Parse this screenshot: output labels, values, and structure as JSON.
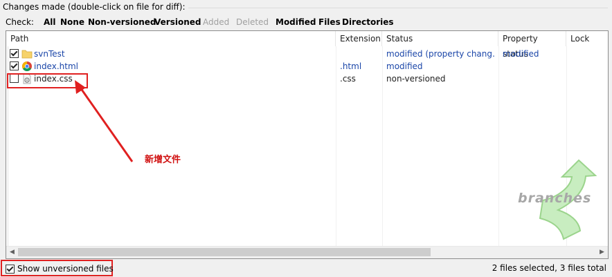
{
  "group": {
    "title": "Changes made (double-click on file for diff):"
  },
  "check_bar": {
    "label": "Check:",
    "links": [
      {
        "label": "All",
        "enabled": true
      },
      {
        "label": "None",
        "enabled": true
      },
      {
        "label": "Non-versioned",
        "enabled": true
      },
      {
        "label": "Versioned",
        "enabled": true
      },
      {
        "label": "Added",
        "enabled": false
      },
      {
        "label": "Deleted",
        "enabled": false
      },
      {
        "label": "Modified",
        "enabled": true
      },
      {
        "label": "Files",
        "enabled": true
      },
      {
        "label": "Directories",
        "enabled": true
      }
    ]
  },
  "columns": [
    "Path",
    "Extension",
    "Status",
    "Property status",
    "Lock"
  ],
  "rows": [
    {
      "checked": true,
      "icon": "folder-icon",
      "path": "svnTest",
      "extension": "",
      "status": "modified (property chang…",
      "property_status": "modified",
      "lock": ""
    },
    {
      "checked": true,
      "icon": "chrome-icon",
      "path": "index.html",
      "extension": ".html",
      "status": "modified",
      "property_status": "",
      "lock": ""
    },
    {
      "checked": false,
      "icon": "css-file-icon",
      "path": "index.css",
      "extension": ".css",
      "status": "non-versioned",
      "property_status": "",
      "lock": ""
    }
  ],
  "annotation": {
    "text": "新增文件",
    "color": "#d01010"
  },
  "watermark": {
    "text": "branches"
  },
  "footer": {
    "show_unversioned_label": "Show unversioned files",
    "show_unversioned_checked": true,
    "selection_summary": "2 files selected, 3 files total"
  },
  "colors": {
    "link_blue": "#1b46a8",
    "annotation_red": "#e02020"
  }
}
